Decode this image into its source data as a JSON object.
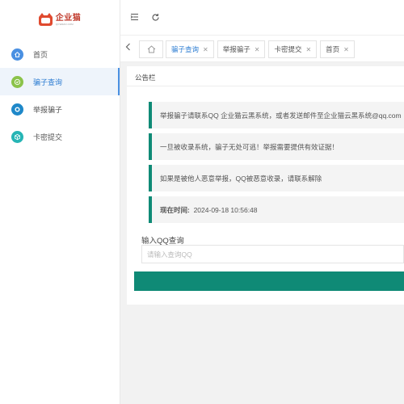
{
  "brand": {
    "name": "企业猫",
    "tagline": "QIYEMAO.COM"
  },
  "sidebar": {
    "items": [
      {
        "label": "首页",
        "icon": "home-icon",
        "color": "#4a90e2",
        "active": false
      },
      {
        "label": "骗子查询",
        "icon": "check-icon",
        "color": "#8bc34a",
        "active": true
      },
      {
        "label": "举报骗子",
        "icon": "ring-icon",
        "color": "#1e88c9",
        "active": false
      },
      {
        "label": "卡密提交",
        "icon": "cube-icon",
        "color": "#26b5b5",
        "active": false
      }
    ]
  },
  "header": {
    "menu_icon": "menu-fold-icon",
    "refresh_icon": "refresh-icon"
  },
  "tabs": [
    {
      "label": "骗子查询",
      "active": true
    },
    {
      "label": "举报骗子",
      "active": false
    },
    {
      "label": "卡密提交",
      "active": false
    },
    {
      "label": "首页",
      "active": false
    }
  ],
  "panel": {
    "title": "公告栏",
    "notices": [
      "举报骗子请联系QQ 企业猫云黑系统，或者发送邮件至企业猫云黑系统@qq.com",
      "一旦被收录系统，骗子无处可逃！举报需要提供有效证据！",
      "如果是被他人恶意举报，QQ被恶意收录，请联系解除"
    ],
    "time_label": "现在时间:",
    "time_value": "2024-09-18 10:56:48",
    "query": {
      "label": "输入QQ查询",
      "placeholder": "请输入查询QQ",
      "value": ""
    }
  },
  "colors": {
    "accent": "#0f8a76",
    "active_blue": "#2d7dd2",
    "brand_red": "#e04a2f"
  }
}
